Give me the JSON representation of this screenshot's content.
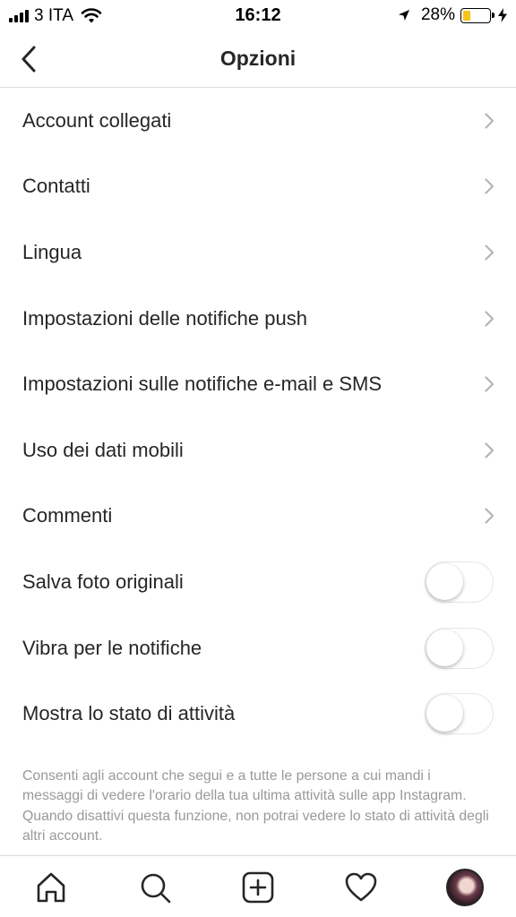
{
  "status_bar": {
    "carrier": "3 ITA",
    "time": "16:12",
    "battery_percent": "28%",
    "battery_level": 0.28,
    "signal_icon": "signal-bars-icon",
    "wifi_icon": "wifi-icon",
    "location_icon": "location-arrow-icon",
    "charging_icon": "bolt-icon"
  },
  "nav": {
    "title": "Opzioni",
    "back_icon": "chevron-left-icon"
  },
  "options": [
    {
      "label": "Account collegati",
      "type": "link"
    },
    {
      "label": "Contatti",
      "type": "link"
    },
    {
      "label": "Lingua",
      "type": "link"
    },
    {
      "label": "Impostazioni delle notifiche push",
      "type": "link"
    },
    {
      "label": "Impostazioni sulle notifiche e-mail e SMS",
      "type": "link"
    },
    {
      "label": "Uso dei dati mobili",
      "type": "link"
    },
    {
      "label": "Commenti",
      "type": "link"
    },
    {
      "label": "Salva foto originali",
      "type": "toggle",
      "on": false
    },
    {
      "label": "Vibra per le notifiche",
      "type": "toggle",
      "on": false
    },
    {
      "label": "Mostra lo stato di attività",
      "type": "toggle",
      "on": false
    }
  ],
  "footnote": "Consenti agli account che segui e a tutte le persone a cui mandi i messaggi di vedere l'orario della tua ultima attività sulle app Instagram. Quando disattivi questa funzione, non potrai vedere lo stato di attività degli altri account.",
  "tab_bar": {
    "items": [
      "home-icon",
      "search-icon",
      "add-post-icon",
      "heart-icon",
      "profile-avatar"
    ]
  },
  "colors": {
    "text": "#262626",
    "secondary_text": "#999999",
    "divider": "#dbdbdb",
    "battery_fill": "#f5c518"
  }
}
